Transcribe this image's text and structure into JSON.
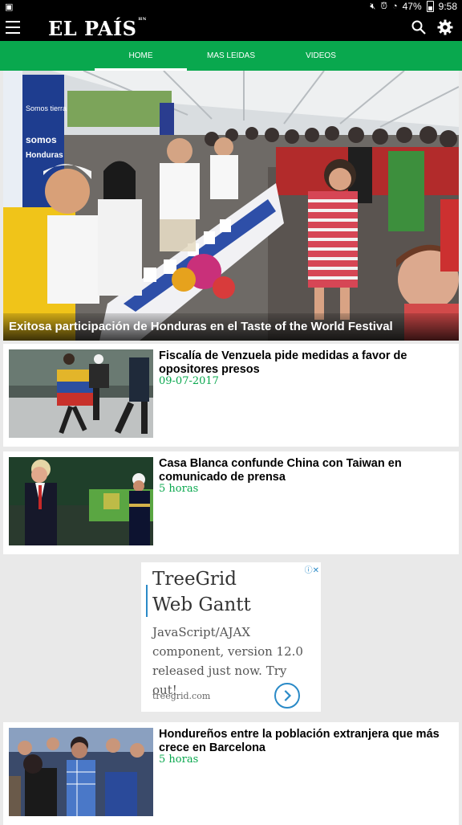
{
  "status_bar": {
    "battery": "47%",
    "time": "9:58"
  },
  "app_bar": {
    "logo": "EL PAÍS",
    "logo_suffix": "HN"
  },
  "tabs": [
    {
      "label": "HOME",
      "active": true
    },
    {
      "label": "MAS LEIDAS",
      "active": false
    },
    {
      "label": "VIDEOS",
      "active": false
    }
  ],
  "colors": {
    "accent_green": "#09a84e",
    "date_green": "#09a84e",
    "ad_blue": "#2a8ac7"
  },
  "hero": {
    "headline": "Exitosa participación de Honduras en el Taste of the World Festival",
    "banner_text_1": "Somos tierra",
    "banner_text_2": "somos",
    "banner_text_3": "Honduras"
  },
  "articles": [
    {
      "title": "Fiscalía de Venzuela pide medidas a favor de opositores presos",
      "date": "09-07-2017"
    },
    {
      "title": "Casa Blanca confunde China con Taiwan en comunicado de prensa",
      "date": "5 horas"
    },
    {
      "title": "Hondureños entre la población extranjera que más crece en Barcelona",
      "date": "5 horas"
    }
  ],
  "ad": {
    "brand_line1": "TreeGrid",
    "brand_line2": "Web Gantt",
    "body": "JavaScript/AJAX component, version 12.0 released just now. Try out!",
    "domain": "treegrid.com"
  }
}
